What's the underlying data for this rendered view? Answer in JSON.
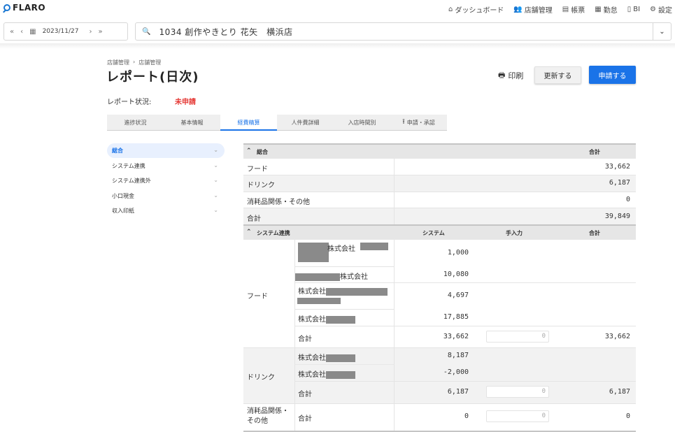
{
  "app": {
    "logo_text": "FLARO"
  },
  "nav": [
    {
      "icon": "home-icon",
      "glyph": "⌂",
      "label": "ダッシュボード"
    },
    {
      "icon": "people-icon",
      "glyph": "👥",
      "label": "店舗管理"
    },
    {
      "icon": "report-icon",
      "glyph": "▤",
      "label": "帳票"
    },
    {
      "icon": "calendar-icon",
      "glyph": "▦",
      "label": "勤怠"
    },
    {
      "icon": "document-icon",
      "glyph": "▯",
      "label": "BI"
    },
    {
      "icon": "gear-icon",
      "glyph": "⚙",
      "label": "設定"
    }
  ],
  "date_nav": {
    "date": "2023/11/27"
  },
  "store_search": {
    "value": "1034 創作やきとり 花矢　横浜店"
  },
  "breadcrumb": [
    "店舗管理",
    "店舗管理"
  ],
  "page_title": "レポート(日次)",
  "actions": {
    "print": "印刷",
    "update": "更新する",
    "apply": "申請する"
  },
  "report_status": {
    "label": "レポート状況:",
    "value": "未申請",
    "color": "#e53935"
  },
  "tabs": [
    "進捗状況",
    "基本情報",
    "経費精算",
    "人件費詳細",
    "入店時間別",
    "申請・承認"
  ],
  "active_tab": "経費精算",
  "side_menu": [
    "総合",
    "システム連携",
    "システム連携外",
    "小口現金",
    "収入印紙"
  ],
  "summary": {
    "title": "総合",
    "col_total": "合計",
    "rows": [
      {
        "label": "フード",
        "value": "33,662"
      },
      {
        "label": "ドリンク",
        "value": "6,187"
      },
      {
        "label": "消耗品関係・その他",
        "value": "0"
      },
      {
        "label": "合計",
        "value": "39,849"
      }
    ]
  },
  "system": {
    "title": "システム連携",
    "col_system": "システム",
    "col_manual": "手入力",
    "col_total": "合計",
    "food": {
      "label": "フード",
      "vendors": [
        {
          "name": "株式会社",
          "value": "1,000"
        },
        {
          "name": "株式会社",
          "value": "10,080"
        },
        {
          "name": "株式会社",
          "value": "4,697"
        },
        {
          "name": "株式会社",
          "value": "17,885"
        }
      ],
      "subtotal": {
        "label": "合計",
        "system": "33,662",
        "manual": "0",
        "total": "33,662"
      }
    },
    "drink": {
      "label": "ドリンク",
      "vendors": [
        {
          "name": "株式会社",
          "value": "8,187"
        },
        {
          "name": "株式会社",
          "value": "-2,000"
        }
      ],
      "subtotal": {
        "label": "合計",
        "system": "6,187",
        "manual": "0",
        "total": "6,187"
      }
    },
    "other": {
      "label": "消耗品関係・その他",
      "subtotal": {
        "label": "合計",
        "system": "0",
        "manual": "0",
        "total": "0"
      }
    }
  }
}
